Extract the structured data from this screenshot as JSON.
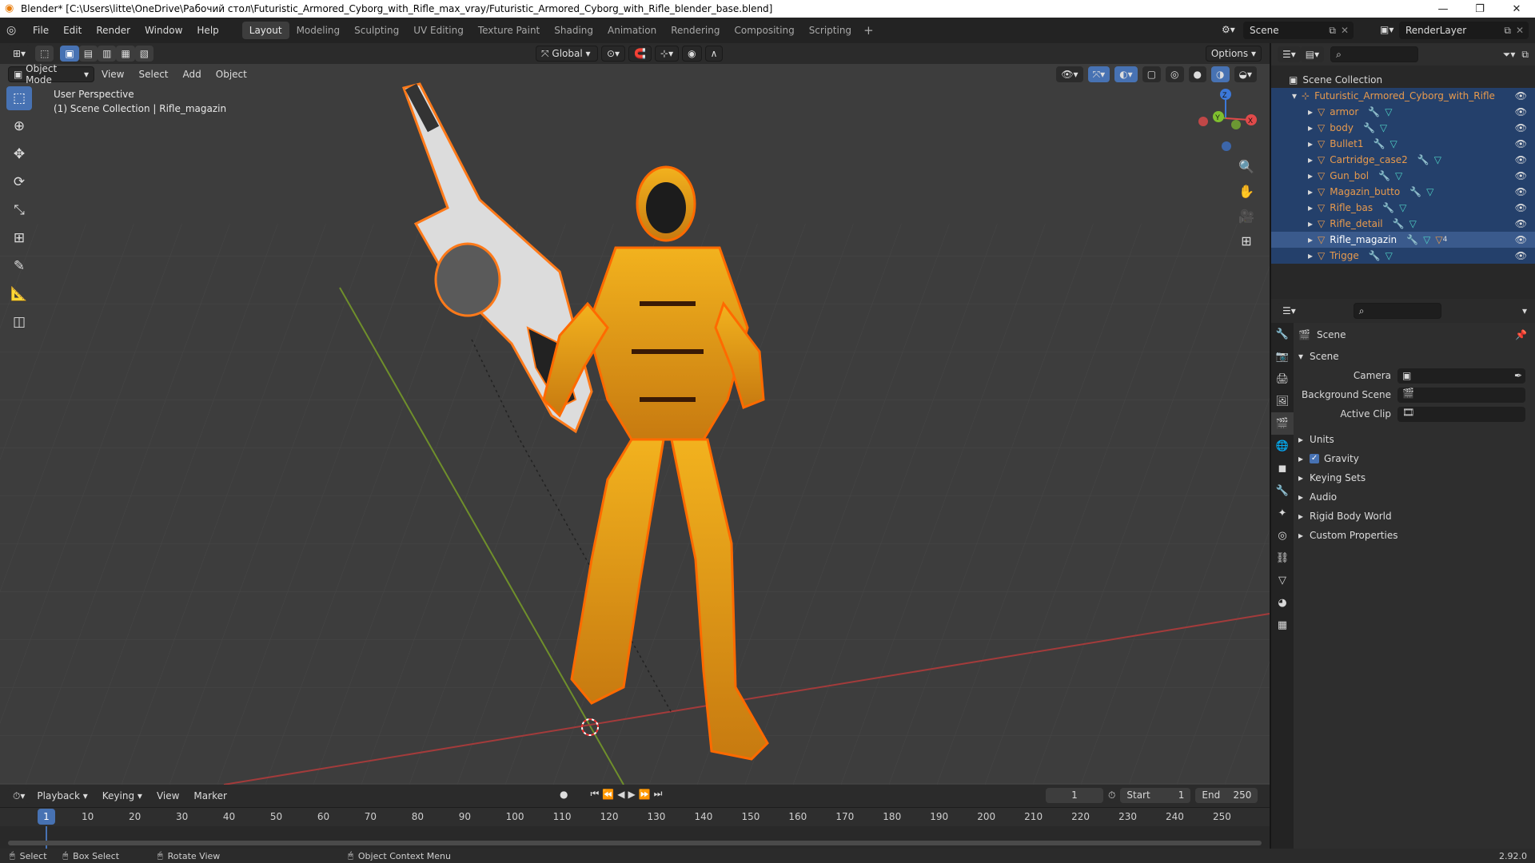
{
  "window": {
    "title": "Blender* [C:\\Users\\litte\\OneDrive\\Рабочий стол\\Futuristic_Armored_Cyborg_with_Rifle_max_vray/Futuristic_Armored_Cyborg_with_Rifle_blender_base.blend]",
    "minimize": "—",
    "maximize": "❐",
    "close": "✕"
  },
  "menu": {
    "items": [
      "File",
      "Edit",
      "Render",
      "Window",
      "Help"
    ]
  },
  "workspaces": [
    "Layout",
    "Modeling",
    "Sculpting",
    "UV Editing",
    "Texture Paint",
    "Shading",
    "Animation",
    "Rendering",
    "Compositing",
    "Scripting"
  ],
  "workspace_active": "Layout",
  "scene_name": "Scene",
  "render_layer": "RenderLayer",
  "viewport_header": {
    "mode": "Object Mode",
    "menus": [
      "View",
      "Select",
      "Add",
      "Object"
    ],
    "transform_orientation": "Global",
    "options": "Options"
  },
  "viewport": {
    "perspective": "User Perspective",
    "collection_info": "(1) Scene Collection | Rifle_magazin",
    "gizmo": {
      "x": "X",
      "y": "Y",
      "z": "Z"
    }
  },
  "tools": [
    "select-box",
    "cursor",
    "move",
    "rotate",
    "scale",
    "transform",
    "annotate",
    "measure",
    "add-cube"
  ],
  "nav_icons": [
    "zoom-icon",
    "hand-icon",
    "camera-icon",
    "grid-icon"
  ],
  "timeline": {
    "menus": [
      "Playback",
      "Keying",
      "View",
      "Marker"
    ],
    "current_frame": "1",
    "start_label": "Start",
    "start": "1",
    "end_label": "End",
    "end": "250",
    "ticks": [
      "10",
      "20",
      "30",
      "40",
      "50",
      "60",
      "70",
      "80",
      "90",
      "100",
      "110",
      "120",
      "130",
      "140",
      "150",
      "160",
      "170",
      "180",
      "190",
      "200",
      "210",
      "220",
      "230",
      "240",
      "250"
    ],
    "playhead": "1"
  },
  "statusbar": {
    "select": "Select",
    "box_select": "Box Select",
    "rotate_view": "Rotate View",
    "context_menu": "Object Context Menu",
    "version": "2.92.0"
  },
  "outliner": {
    "root": "Scene Collection",
    "collection": "Futuristic_Armored_Cyborg_with_Rifle",
    "objects": [
      "armor",
      "body",
      "Bullet1",
      "Cartridge_case2",
      "Gun_bol",
      "Magazin_butto",
      "Rifle_bas",
      "Rifle_detail",
      "Rifle_magazin",
      "Trigge"
    ],
    "active_object": "Rifle_magazin",
    "badge": "4"
  },
  "properties": {
    "breadcrumb": "Scene",
    "panel": "Scene",
    "camera_label": "Camera",
    "background_scene_label": "Background Scene",
    "active_clip_label": "Active Clip",
    "sections": [
      "Units",
      "Gravity",
      "Keying Sets",
      "Audio",
      "Rigid Body World",
      "Custom Properties"
    ]
  },
  "colors": {
    "accent": "#4772b3",
    "selection_outline": "#e8650d",
    "object_text": "#e89a4d",
    "viewport_bg": "#3d3d3d"
  }
}
